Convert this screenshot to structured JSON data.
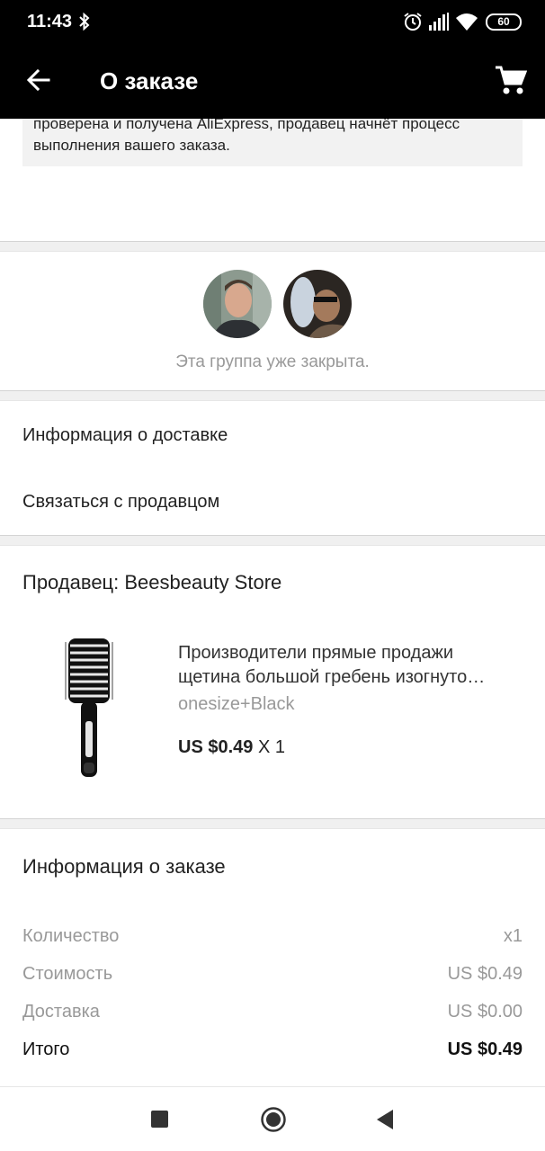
{
  "status_bar": {
    "time": "11:43",
    "battery": "60",
    "icons": [
      "bluetooth-icon",
      "alarm-icon",
      "signal-icon",
      "wifi-icon",
      "battery-icon"
    ]
  },
  "app_bar": {
    "title": "О заказе",
    "back_icon": "arrow-left-icon",
    "cart_icon": "cart-icon"
  },
  "notice": {
    "line1": "проверена и получена AliExpress, продавец начнёт процесс",
    "line2": "выполнения вашего заказа."
  },
  "group": {
    "status": "Эта группа уже закрыта."
  },
  "links": {
    "delivery_info": "Информация о доставке",
    "contact_seller": "Связаться с продавцом"
  },
  "seller": {
    "label": "Продавец: Beesbeauty Store"
  },
  "product": {
    "title_line1": "Производители прямые продажи",
    "title_line2": "щетина большой гребень изогнуто…",
    "variant": "onesize+Black",
    "price": "US $0.49",
    "quantity": "X 1"
  },
  "order_info": {
    "title": "Информация о заказе",
    "rows": [
      {
        "label": "Количество",
        "value": "x1"
      },
      {
        "label": "Стоимость",
        "value": "US $0.49"
      },
      {
        "label": "Доставка",
        "value": "US $0.00"
      },
      {
        "label": "Итого",
        "value": "US $0.49"
      }
    ]
  },
  "colors": {
    "app_bar": "#000000",
    "muted_text": "#999999",
    "divider": "#f0f0f0"
  }
}
